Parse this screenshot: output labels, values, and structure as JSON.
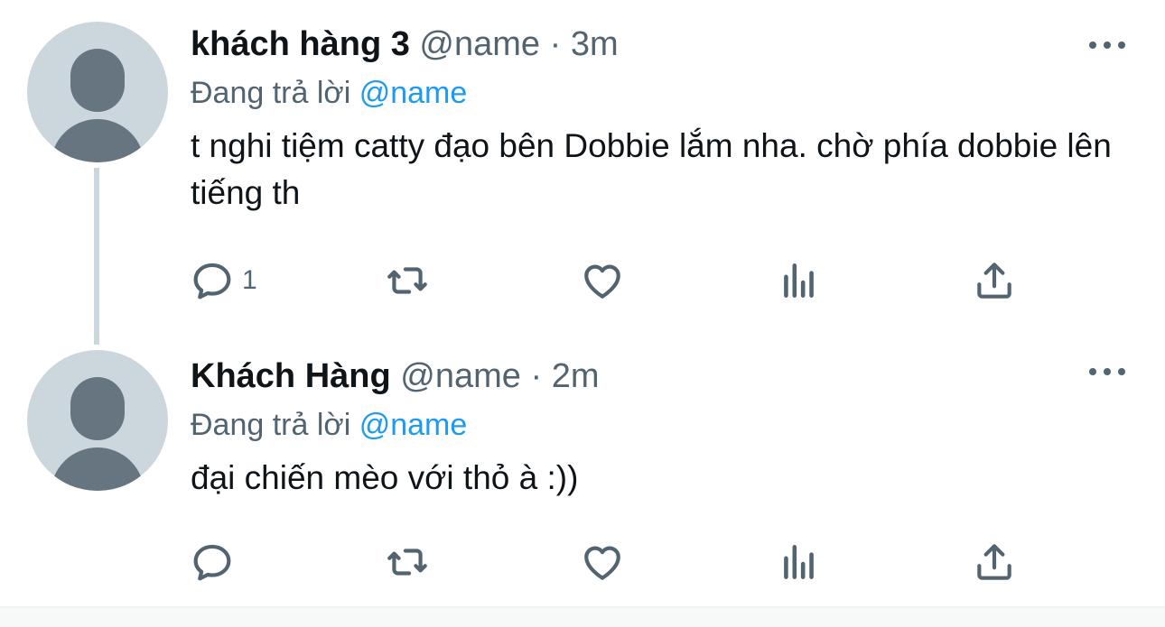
{
  "tweets": [
    {
      "display_name": "khách hàng 3",
      "handle": "@name",
      "separator": "·",
      "time": "3m",
      "replying_prefix": "Đang trả lời",
      "replying_handle": "@name",
      "text": "t nghi tiệm catty đạo bên Dobbie lắm nha. chờ phía dobbie lên tiếng th",
      "reply_count": "1"
    },
    {
      "display_name": "Khách Hàng",
      "handle": "@name",
      "separator": "·",
      "time": "2m",
      "replying_prefix": "Đang trả lời",
      "replying_handle": "@name",
      "text": "đại chiến mèo với thỏ à :))",
      "reply_count": ""
    }
  ],
  "icons": [
    "avatar-placeholder-icon",
    "more-icon",
    "reply-icon",
    "retweet-icon",
    "like-icon",
    "stats-icon",
    "share-icon"
  ],
  "colors": {
    "link": "#1d9bf0",
    "secondary_text": "#536471",
    "avatar_bg": "#ccd6dd",
    "avatar_fg": "#66757f"
  }
}
